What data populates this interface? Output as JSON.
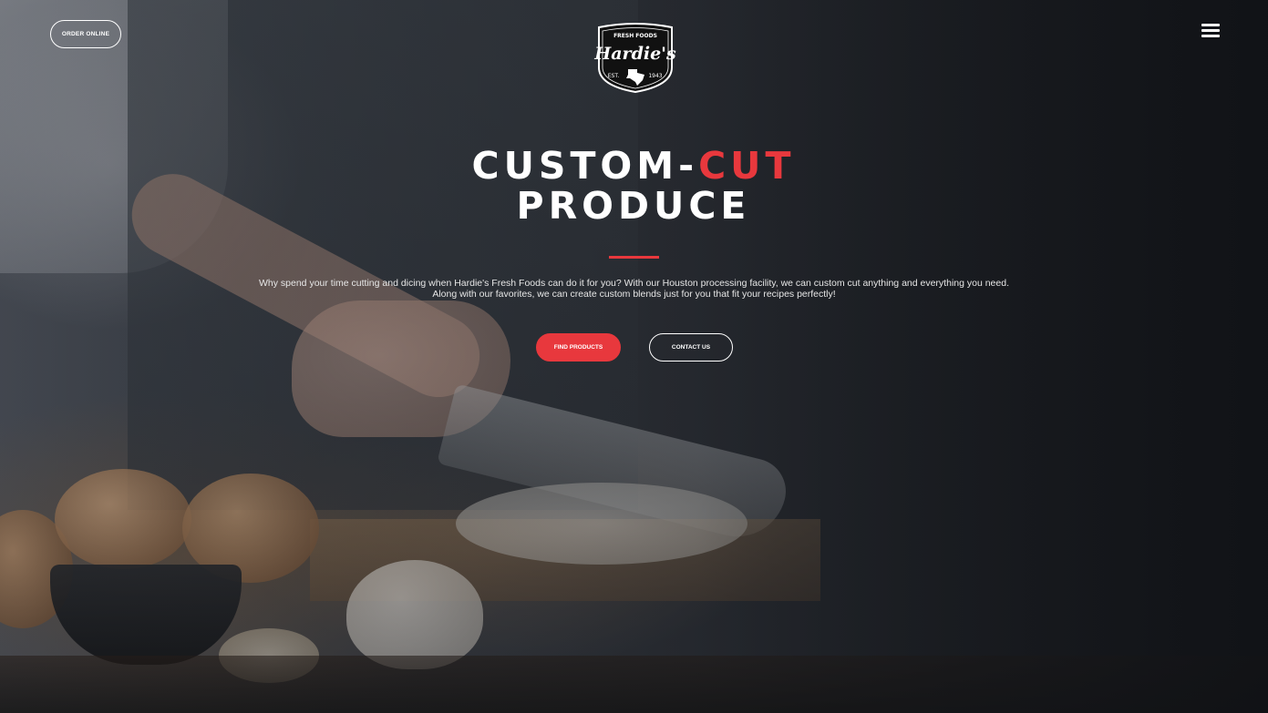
{
  "header": {
    "order_label": "ORDER ONLINE",
    "logo": {
      "top": "FRESH FOODS",
      "name": "Hardie's",
      "est": "EST.",
      "year": "1943"
    }
  },
  "hero": {
    "headline_part1": "CUSTOM-",
    "headline_accent": "CUT",
    "headline_line2": "PRODUCE",
    "description": "Why spend your time cutting and dicing when Hardie's Fresh Foods can do it for you? With our Houston processing facility, we can custom cut anything and everything you need. Along with our favorites, we can create custom blends just for you that fit your recipes perfectly!",
    "primary_button": "FIND PRODUCTS",
    "secondary_button": "CONTACT US"
  },
  "icons": {
    "menu": "hamburger-menu-icon",
    "texas": "texas-state-icon"
  },
  "colors": {
    "accent": "#e8383d",
    "text": "#ffffff"
  }
}
